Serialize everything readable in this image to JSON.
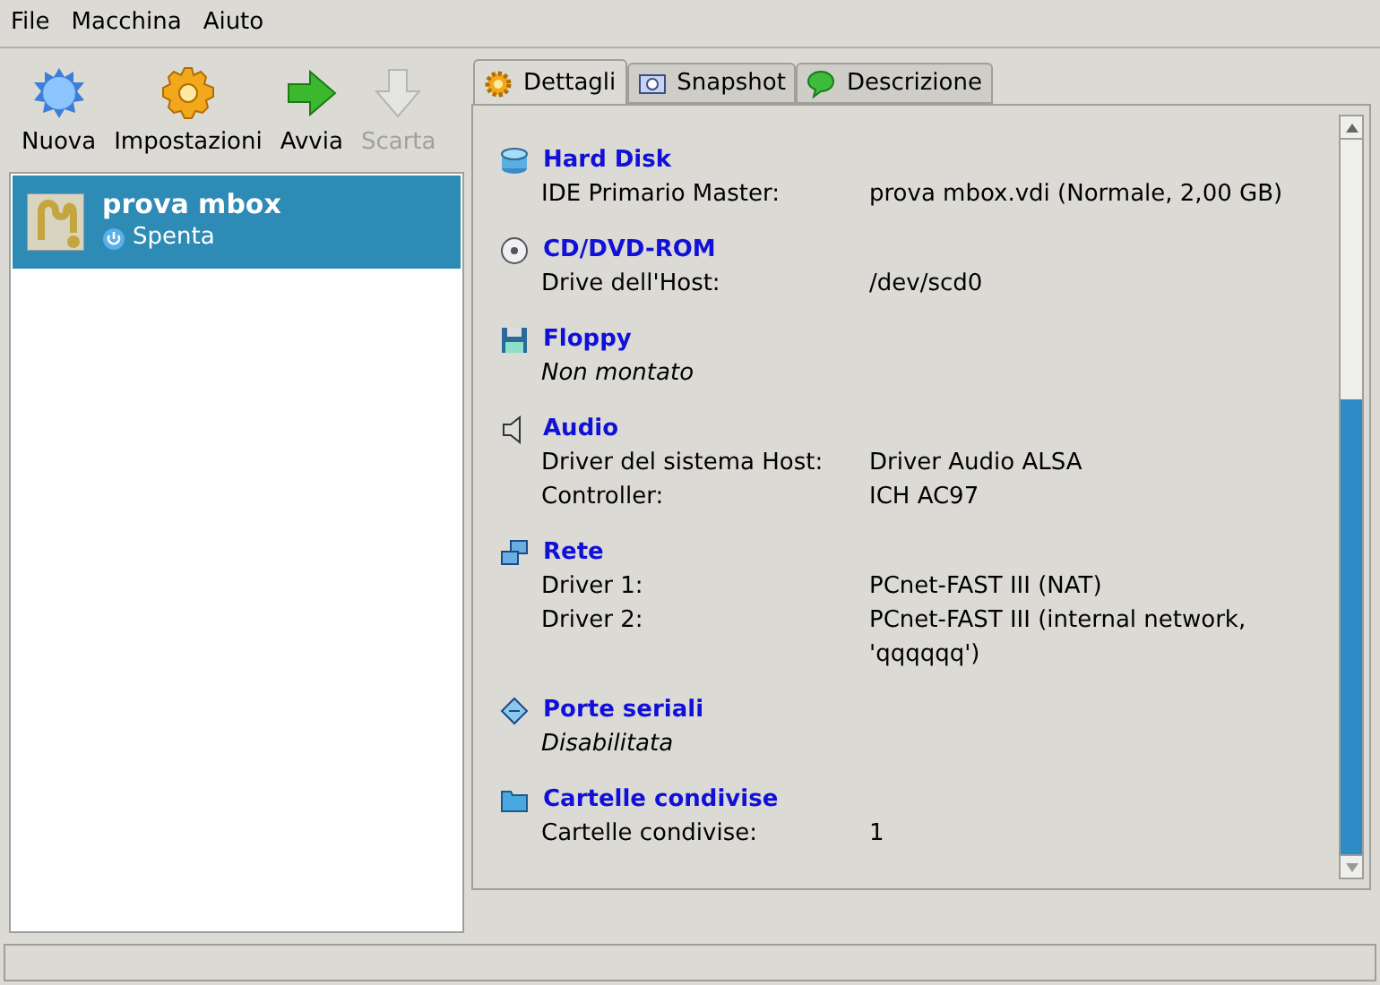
{
  "menu": [
    "File",
    "Macchina",
    "Aiuto"
  ],
  "toolbar": [
    {
      "label": "Nuova",
      "disabled": false
    },
    {
      "label": "Impostazioni",
      "disabled": false
    },
    {
      "label": "Avvia",
      "disabled": false
    },
    {
      "label": "Scarta",
      "disabled": true
    }
  ],
  "vm_list": [
    {
      "name": "prova mbox",
      "state": "Spenta",
      "selected": true
    }
  ],
  "tabs": [
    {
      "label": "Dettagli",
      "selected": true
    },
    {
      "label": "Snapshot",
      "selected": false
    },
    {
      "label": "Descrizione",
      "selected": false
    }
  ],
  "sections": [
    {
      "title": "Hard Disk",
      "items": [
        {
          "kind": "row",
          "label": "IDE Primario Master:",
          "value": "prova mbox.vdi (Normale, 2,00 GB)"
        }
      ]
    },
    {
      "title": "CD/DVD-ROM",
      "items": [
        {
          "kind": "row",
          "label": "Drive dell'Host:",
          "value": "/dev/scd0"
        }
      ]
    },
    {
      "title": "Floppy",
      "items": [
        {
          "kind": "note",
          "text": "Non montato"
        }
      ]
    },
    {
      "title": "Audio",
      "items": [
        {
          "kind": "row",
          "label": "Driver del sistema Host:",
          "value": "Driver Audio ALSA"
        },
        {
          "kind": "row",
          "label": "Controller:",
          "value": "ICH AC97"
        }
      ]
    },
    {
      "title": "Rete",
      "items": [
        {
          "kind": "row",
          "label": "Driver 1:",
          "value": "PCnet-FAST III (NAT)"
        },
        {
          "kind": "row",
          "label": "Driver 2:",
          "value": "PCnet-FAST III (internal network, 'qqqqqq')"
        }
      ]
    },
    {
      "title": "Porte seriali",
      "items": [
        {
          "kind": "note",
          "text": "Disabilitata"
        }
      ]
    },
    {
      "title": "Cartelle condivise",
      "items": [
        {
          "kind": "row",
          "label": "Cartelle condivise:",
          "value": "1"
        }
      ]
    }
  ]
}
